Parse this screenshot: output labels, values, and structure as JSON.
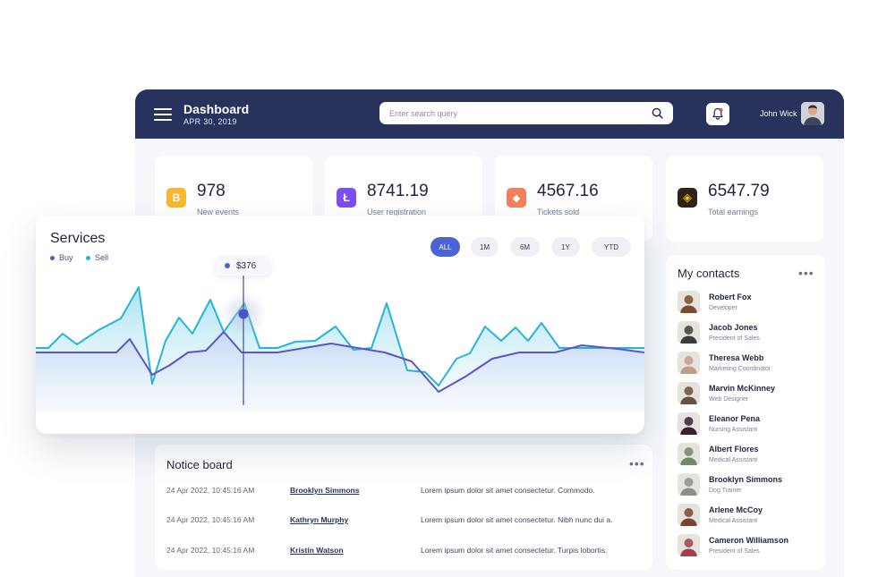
{
  "header": {
    "title": "Dashboard",
    "date": "APR 30, 2019",
    "search_placeholder": "Enter search query",
    "user_name": "John Wick"
  },
  "stats": [
    {
      "value": "978",
      "label": "New events",
      "icon": "bitcoin-icon",
      "color": "#f5b82e",
      "glyph": "B"
    },
    {
      "value": "8741.19",
      "label": "User registration",
      "icon": "litecoin-icon",
      "color": "#7b4ff0",
      "glyph": "Ł"
    },
    {
      "value": "4567.16",
      "label": "Tickets sold",
      "icon": "ethereum-icon",
      "color": "#f37f5c",
      "glyph": "◆"
    },
    {
      "value": "6547.79",
      "label": "Total earnings",
      "icon": "binance-icon",
      "color": "#2b2417",
      "glyph": "◈"
    }
  ],
  "services": {
    "title": "Services",
    "legend": [
      {
        "name": "Buy",
        "color": "#5b56c8"
      },
      {
        "name": "Sell",
        "color": "#26b5d8"
      }
    ],
    "ranges": [
      "ALL",
      "1M",
      "6M",
      "1Y",
      "YTD"
    ],
    "active_range": "ALL",
    "tooltip": "$376"
  },
  "chart_data": {
    "type": "area",
    "title": "Services",
    "xlabel": "",
    "ylabel": "",
    "grid": false,
    "legend": "top-left",
    "series": [
      {
        "name": "Sell",
        "color": "#26b5d8",
        "points": [
          [
            0,
            148
          ],
          [
            14,
            148
          ],
          [
            30,
            132
          ],
          [
            46,
            144
          ],
          [
            70,
            128
          ],
          [
            95,
            115
          ],
          [
            115,
            80
          ],
          [
            130,
            188
          ],
          [
            145,
            140
          ],
          [
            160,
            114
          ],
          [
            175,
            132
          ],
          [
            195,
            94
          ],
          [
            210,
            130
          ],
          [
            233,
            98
          ],
          [
            250,
            148
          ],
          [
            270,
            148
          ],
          [
            290,
            141
          ],
          [
            312,
            140
          ],
          [
            335,
            124
          ],
          [
            355,
            150
          ],
          [
            375,
            148
          ],
          [
            392,
            98
          ],
          [
            415,
            173
          ],
          [
            435,
            175
          ],
          [
            450,
            190
          ],
          [
            470,
            160
          ],
          [
            485,
            154
          ],
          [
            502,
            124
          ],
          [
            520,
            140
          ],
          [
            536,
            125
          ],
          [
            550,
            140
          ],
          [
            565,
            120
          ],
          [
            585,
            148
          ],
          [
            610,
            148
          ],
          [
            680,
            148
          ]
        ]
      },
      {
        "name": "Buy",
        "color": "#5b56c8",
        "points": [
          [
            0,
            153
          ],
          [
            20,
            153
          ],
          [
            50,
            153
          ],
          [
            90,
            153
          ],
          [
            105,
            138
          ],
          [
            130,
            178
          ],
          [
            150,
            167
          ],
          [
            170,
            153
          ],
          [
            190,
            151
          ],
          [
            210,
            130
          ],
          [
            230,
            153
          ],
          [
            270,
            153
          ],
          [
            300,
            148
          ],
          [
            330,
            143
          ],
          [
            360,
            148
          ],
          [
            390,
            153
          ],
          [
            420,
            163
          ],
          [
            450,
            197
          ],
          [
            480,
            180
          ],
          [
            510,
            160
          ],
          [
            540,
            153
          ],
          [
            580,
            153
          ],
          [
            610,
            145
          ],
          [
            650,
            149
          ],
          [
            680,
            153
          ]
        ]
      }
    ],
    "highlight": {
      "x": 232,
      "y": 110,
      "label": "$376"
    }
  },
  "contacts": {
    "title": "My contacts",
    "items": [
      {
        "name": "Robert Fox",
        "role": "Developer",
        "color": "#7a4a2e"
      },
      {
        "name": "Jacob Jones",
        "role": "President of Sales",
        "color": "#3d3d3d"
      },
      {
        "name": "Theresa Webb",
        "role": "Marketing Coordinator",
        "color": "#c69b8a"
      },
      {
        "name": "Marvin McKinney",
        "role": "Web Designer",
        "color": "#6b4f3f"
      },
      {
        "name": "Eleanor Pena",
        "role": "Nursing Assistant",
        "color": "#3b1e3a"
      },
      {
        "name": "Albert Flores",
        "role": "Medical Assistant",
        "color": "#6f8a6a"
      },
      {
        "name": "Brooklyn Simmons",
        "role": "Dog Trainer",
        "color": "#8f8f8f"
      },
      {
        "name": "Arlene McCoy",
        "role": "Medical Assistant",
        "color": "#7a4530"
      },
      {
        "name": "Cameron Williamson",
        "role": "President of Sales",
        "color": "#a0404a"
      }
    ]
  },
  "notice": {
    "title": "Notice board",
    "rows": [
      {
        "date": "24 Apr 2022, 10:45:16 AM",
        "name": "Brooklyn Simmons",
        "message": "Lorem ipsum dolor sit amet consectetur. Commodo."
      },
      {
        "date": "24 Apr 2022, 10:45:16 AM",
        "name": "Kathryn Murphy",
        "message": "Lorem ipsum dolor sit amet consectetur. Nibh nunc dui a."
      },
      {
        "date": "24 Apr 2022, 10:45:16 AM",
        "name": "Kristin Watson",
        "message": "Lorem ipsum dolor sit amet consectetur. Turpis lobortis."
      }
    ]
  }
}
